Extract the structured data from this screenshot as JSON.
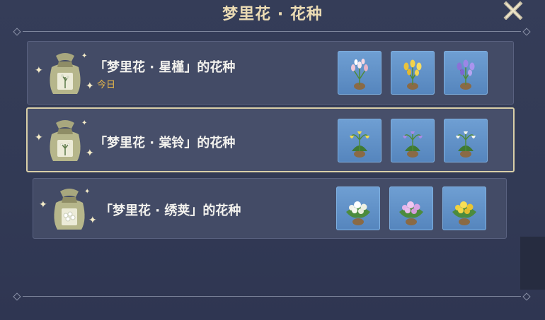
{
  "window": {
    "title": "梦里花 · 花种"
  },
  "seeds": [
    {
      "name": "「梦里花 · 星槿」的花种",
      "tag": "今日",
      "flowers": [
        {
          "icon": "pink-white-flower-icon"
        },
        {
          "icon": "yellow-flower-icon"
        },
        {
          "icon": "purple-flower-icon"
        }
      ]
    },
    {
      "name": "「梦里花 · 棠铃」的花种",
      "flowers": [
        {
          "icon": "yellow-bell-flower-icon"
        },
        {
          "icon": "purple-bell-flower-icon"
        },
        {
          "icon": "white-bell-flower-icon"
        }
      ]
    },
    {
      "name": "「梦里花 · 绣荚」的花种",
      "flowers": [
        {
          "icon": "white-cluster-flower-icon"
        },
        {
          "icon": "pink-cluster-flower-icon"
        },
        {
          "icon": "yellow-cluster-flower-icon"
        }
      ]
    }
  ],
  "colors": {
    "accent": "#ecdcb4",
    "today": "#e9b94a",
    "tile": "#5f90c8"
  }
}
